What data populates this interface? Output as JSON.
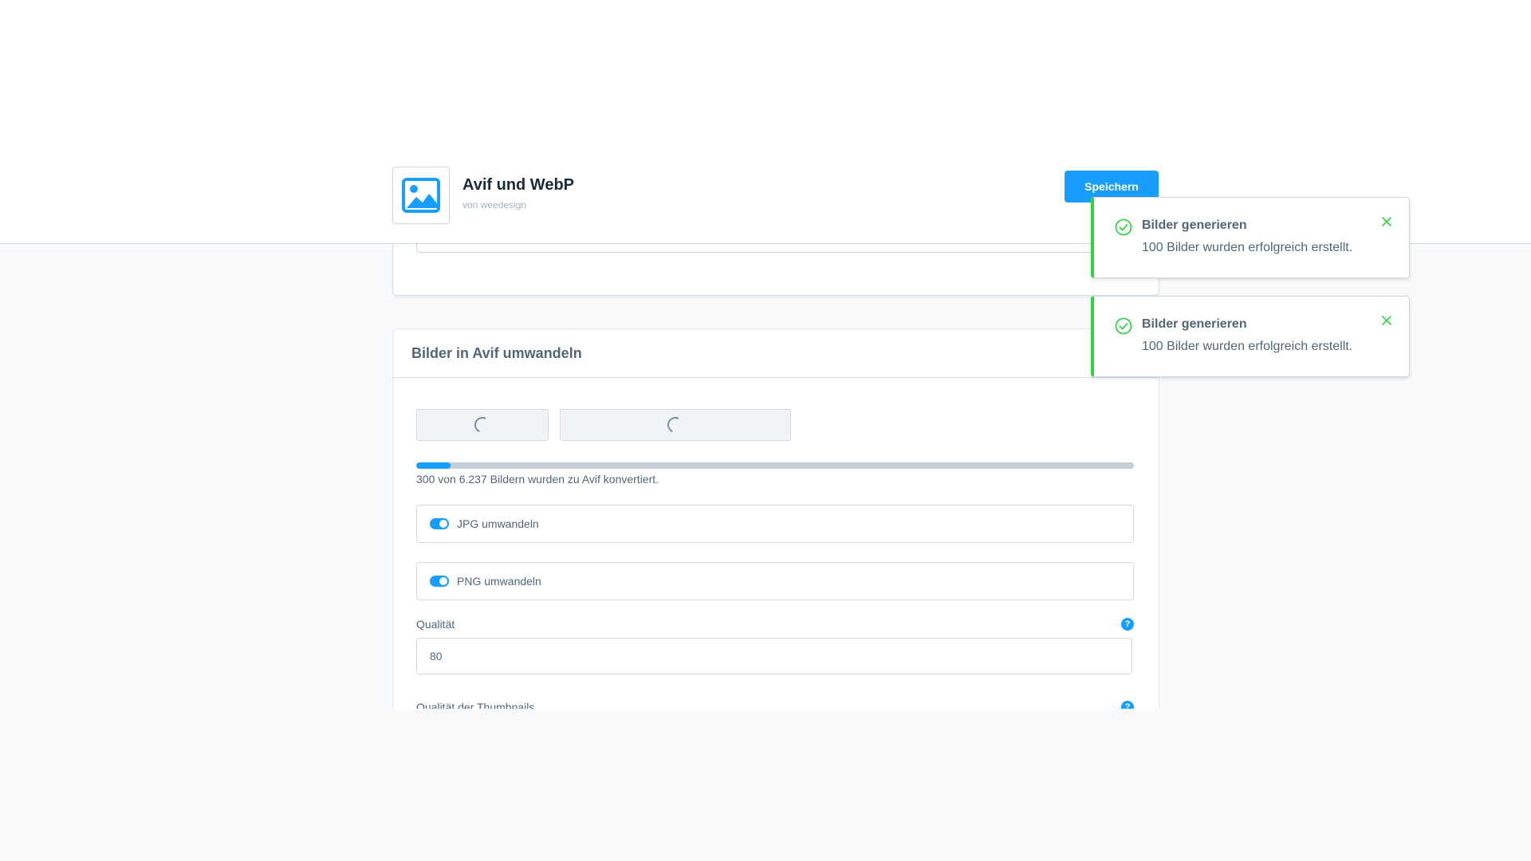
{
  "header": {
    "app_title": "Avif und WebP",
    "app_vendor": "von weedesign",
    "save_label": "Speichern"
  },
  "avif_card": {
    "title": "Bilder in Avif umwandeln",
    "progress_percent": 4.8,
    "progress_text": "300 von 6.237 Bildern wurden zu Avif konvertiert.",
    "jpg_toggle": {
      "label": "JPG umwandeln",
      "enabled": true
    },
    "png_toggle": {
      "label": "PNG umwandeln",
      "enabled": true
    },
    "quality_label": "Qualität",
    "quality_value": "80",
    "thumbnail_quality_label": "Qualität der Thumbnails",
    "help_symbol": "?"
  },
  "notifications": [
    {
      "title": "Bilder generieren",
      "message": "100 Bilder wurden erfolgreich erstellt.",
      "icon": "check-circle-icon"
    },
    {
      "title": "Bilder generieren",
      "message": "100 Bilder wurden erfolgreich erstellt.",
      "icon": "check-circle-icon"
    }
  ],
  "colors": {
    "primary": "#189eff",
    "success": "#37d046",
    "text": "#52667a",
    "border": "#d1d9e0"
  }
}
